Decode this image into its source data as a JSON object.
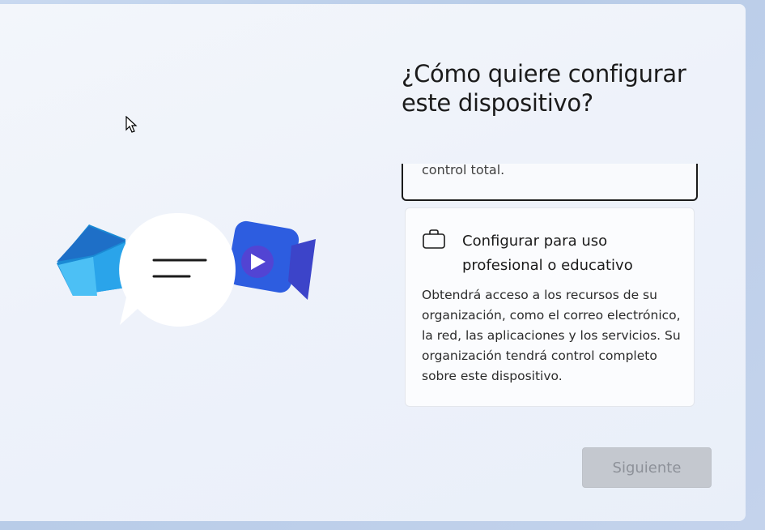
{
  "title": "¿Cómo quiere configurar este dispositivo?",
  "options": [
    {
      "label": "",
      "visible_text": "control total."
    },
    {
      "icon": "briefcase-icon",
      "label": "Configurar para uso profesional o educativo",
      "description": "Obtendrá acceso a los recursos de su organización, como el correo electrónico, la red, las aplicaciones y los servicios. Su organización tendrá control completo sobre este dispositivo."
    }
  ],
  "next_button": {
    "label": "Siguiente",
    "enabled": false
  },
  "illustration": {
    "icons": [
      "mail-icon",
      "chat-bubble-icon",
      "video-icon"
    ]
  }
}
